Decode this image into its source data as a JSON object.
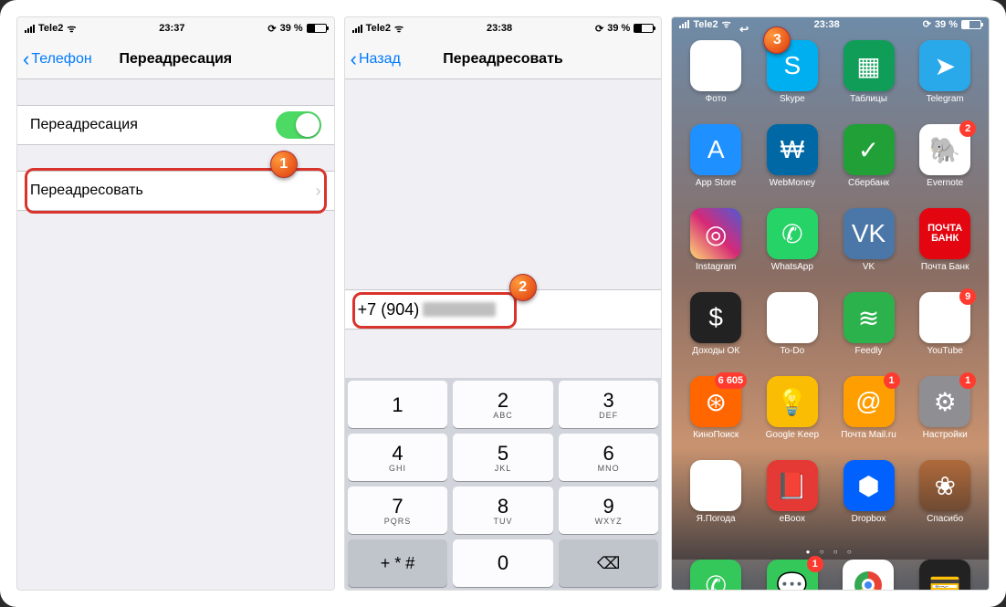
{
  "markers": {
    "m1": "1",
    "m2": "2",
    "m3": "3"
  },
  "status": {
    "carrier": "Tele2",
    "wifi": "ᯤ",
    "time1": "23:37",
    "time2": "23:38",
    "time3": "23:38",
    "batt": "39 %"
  },
  "screen1": {
    "back": "Телефон",
    "title": "Переадресация",
    "toggleLabel": "Переадресация",
    "forwardRow": "Переадресовать"
  },
  "screen2": {
    "back": "Назад",
    "title": "Переадресовать",
    "phone": "+7 (904)",
    "keys": [
      [
        "1",
        ""
      ],
      [
        "2",
        "ABC"
      ],
      [
        "3",
        "DEF"
      ],
      [
        "4",
        "GHI"
      ],
      [
        "5",
        "JKL"
      ],
      [
        "6",
        "MNO"
      ],
      [
        "7",
        "PQRS"
      ],
      [
        "8",
        "TUV"
      ],
      [
        "9",
        "WXYZ"
      ]
    ],
    "fnLeft": "+ * #",
    "zero": "0",
    "del": "⌫"
  },
  "home": {
    "apps": [
      {
        "name": "Фото",
        "cls": "c-white",
        "glyph": "✿"
      },
      {
        "name": "Skype",
        "cls": "c-skype",
        "glyph": "S"
      },
      {
        "name": "Таблицы",
        "cls": "c-sheets",
        "glyph": "▦"
      },
      {
        "name": "Telegram",
        "cls": "c-tg",
        "glyph": "➤"
      },
      {
        "name": "App Store",
        "cls": "c-astore",
        "glyph": "A"
      },
      {
        "name": "WebMoney",
        "cls": "c-wm",
        "glyph": "₩"
      },
      {
        "name": "Сбербанк",
        "cls": "c-sber",
        "glyph": "✓"
      },
      {
        "name": "Evernote",
        "cls": "c-ev",
        "glyph": "🐘",
        "badge": "2"
      },
      {
        "name": "Instagram",
        "cls": "c-ig",
        "glyph": "◎"
      },
      {
        "name": "WhatsApp",
        "cls": "c-wa",
        "glyph": "✆"
      },
      {
        "name": "VK",
        "cls": "c-vk",
        "glyph": "VK"
      },
      {
        "name": "Почта Банк",
        "cls": "c-pb",
        "glyph": "",
        "pb": true
      },
      {
        "name": "Доходы ОК",
        "cls": "c-dok",
        "glyph": "$"
      },
      {
        "name": "To-Do",
        "cls": "c-todo",
        "glyph": "✓"
      },
      {
        "name": "Feedly",
        "cls": "c-feed",
        "glyph": "≋"
      },
      {
        "name": "YouTube",
        "cls": "c-yt",
        "glyph": "▶",
        "badge": "9"
      },
      {
        "name": "КиноПоиск",
        "cls": "c-kp",
        "glyph": "⊛",
        "badge": "6 605"
      },
      {
        "name": "Google Keep",
        "cls": "c-keep",
        "glyph": "💡"
      },
      {
        "name": "Почта Mail.ru",
        "cls": "c-mail",
        "glyph": "@",
        "badge": "1"
      },
      {
        "name": "Настройки",
        "cls": "c-set",
        "glyph": "⚙",
        "badge": "1"
      },
      {
        "name": "Я.Погода",
        "cls": "c-yw",
        "glyph": "☂"
      },
      {
        "name": "eBoox",
        "cls": "c-eb",
        "glyph": "📕"
      },
      {
        "name": "Dropbox",
        "cls": "c-db",
        "glyph": "⬢"
      },
      {
        "name": "Спасибо",
        "cls": "c-sp",
        "glyph": "❀"
      }
    ],
    "dock": [
      {
        "name": "phone",
        "cls": "c-phone",
        "glyph": "✆"
      },
      {
        "name": "messages",
        "cls": "c-msg",
        "glyph": "💬",
        "badge": "1"
      },
      {
        "name": "chrome",
        "cls": "c-chrome",
        "glyph": "",
        "chrome": true
      },
      {
        "name": "wallet",
        "cls": "c-wallet",
        "glyph": "💳"
      }
    ]
  }
}
